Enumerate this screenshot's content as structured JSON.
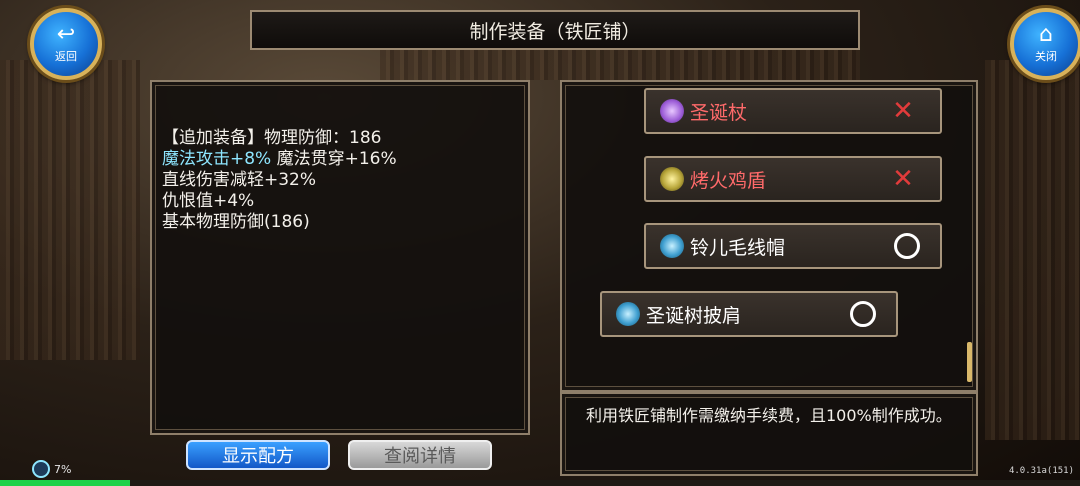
{
  "nav": {
    "back_glyph": "↩",
    "back_label": "返回",
    "close_glyph": "⌂",
    "close_label": "关闭"
  },
  "title": "制作装备（铁匠铺）",
  "details": {
    "line1": "【追加装备】物理防御：186",
    "line2_cyan": "魔法攻击+8%",
    "line2_rest": " 魔法贯穿+16%",
    "line3": "直线伤害减轻+32%",
    "line4": "仇恨值+4%",
    "line5": "基本物理防御(186)"
  },
  "items": [
    {
      "label": "圣诞杖",
      "mark": "✕",
      "label_color": "#ff6a6a",
      "status": "unavailable",
      "icon": "staff-icon"
    },
    {
      "label": "烤火鸡盾",
      "mark": "✕",
      "label_color": "#ff6a6a",
      "status": "unavailable",
      "icon": "shield-icon"
    },
    {
      "label": "铃儿毛线帽",
      "mark": "",
      "label_color": "#ffffff",
      "status": "available",
      "icon": "hat-icon"
    },
    {
      "label": "圣诞树披肩",
      "mark": "",
      "label_color": "#ffffff",
      "status": "available",
      "icon": "cape-icon"
    }
  ],
  "info": "利用铁匠铺制作需缴纳手续费，且100%制作成功。",
  "buttons": {
    "show_recipe": "显示配方",
    "view_details": "查阅详情"
  },
  "status": {
    "percent_text": "7%",
    "version": "4.0.31a(151)"
  },
  "colors": {
    "accent_blue": "#1670d6",
    "cyan_text": "#8ee6ff",
    "red_mark": "#e23b3b",
    "gold_border": "#d8b25a"
  }
}
